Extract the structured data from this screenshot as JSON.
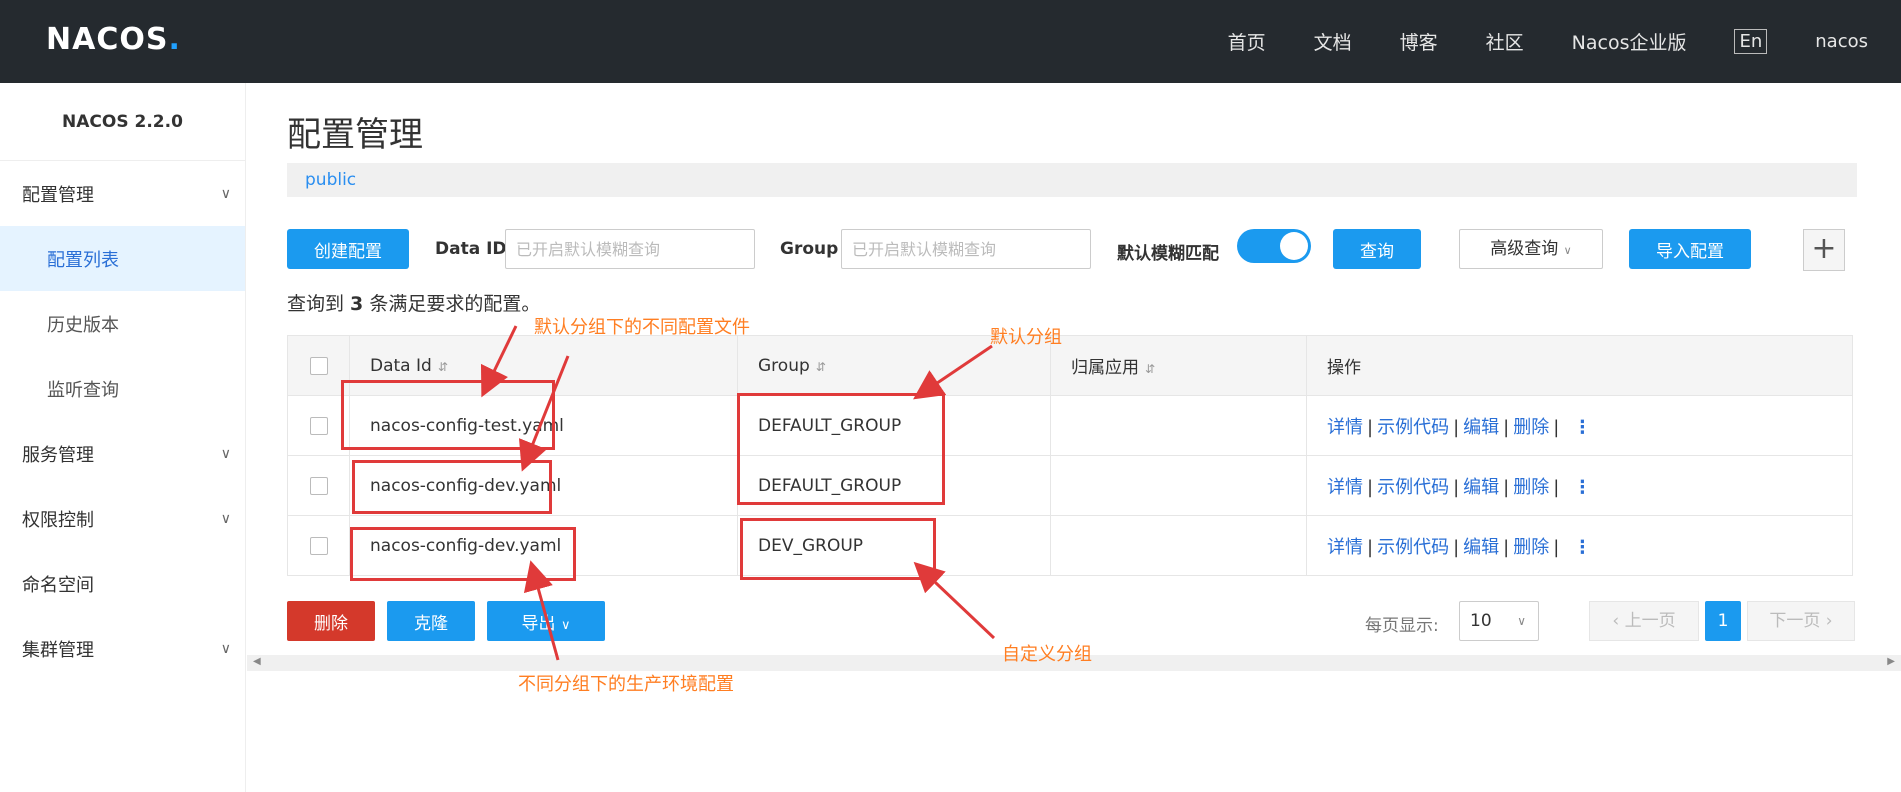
{
  "header": {
    "logo_text": "NACOS",
    "logo_dot": ".",
    "nav": [
      "首页",
      "文档",
      "博客",
      "社区",
      "Nacos企业版"
    ],
    "lang": "En",
    "user": "nacos"
  },
  "sidebar": {
    "version": "NACOS 2.2.0",
    "items": [
      {
        "label": "配置管理",
        "type": "group"
      },
      {
        "label": "配置列表",
        "type": "item",
        "active": true
      },
      {
        "label": "历史版本",
        "type": "item"
      },
      {
        "label": "监听查询",
        "type": "item"
      },
      {
        "label": "服务管理",
        "type": "group"
      },
      {
        "label": "权限控制",
        "type": "group"
      },
      {
        "label": "命名空间",
        "type": "plain"
      },
      {
        "label": "集群管理",
        "type": "group"
      }
    ]
  },
  "main": {
    "title": "配置管理",
    "namespace": "public",
    "toolbar": {
      "create_label": "创建配置",
      "dataid_label": "Data ID",
      "dataid_placeholder": "已开启默认模糊查询",
      "group_label": "Group",
      "group_placeholder": "已开启默认模糊查询",
      "fuzzy_label": "默认模糊匹配",
      "fuzzy_on": true,
      "query_label": "查询",
      "advanced_label": "高级查询",
      "import_label": "导入配置",
      "plus_label": "+"
    },
    "result": {
      "prefix": "查询到 ",
      "count": "3",
      "suffix": " 条满足要求的配置。"
    },
    "table": {
      "headers": [
        "Data Id",
        "Group",
        "归属应用",
        "操作"
      ],
      "sort_icon": "⇵",
      "rows": [
        {
          "data_id": "nacos-config-test.yaml",
          "group": "DEFAULT_GROUP",
          "app": ""
        },
        {
          "data_id": "nacos-config-dev.yaml",
          "group": "DEFAULT_GROUP",
          "app": ""
        },
        {
          "data_id": "nacos-config-dev.yaml",
          "group": "DEV_GROUP",
          "app": ""
        }
      ],
      "ops": [
        "详情",
        "示例代码",
        "编辑",
        "删除"
      ]
    },
    "footer": {
      "delete_label": "删除",
      "clone_label": "克隆",
      "export_label": "导出",
      "page_size_label": "每页显示:",
      "page_size": "10",
      "prev_label": "上一页",
      "next_label": "下一页",
      "current_page": "1"
    },
    "annotations": {
      "default_files": "默认分组下的不同配置文件",
      "default_group": "默认分组",
      "custom_group": "自定义分组",
      "prod_config": "不同分组下的生产环境配置"
    }
  },
  "colors": {
    "topbar": "#252a2f",
    "primary": "#1b9aef",
    "danger": "#d4392b",
    "annotation_box": "#e03a3a",
    "annotation_text": "#ff7e22"
  }
}
